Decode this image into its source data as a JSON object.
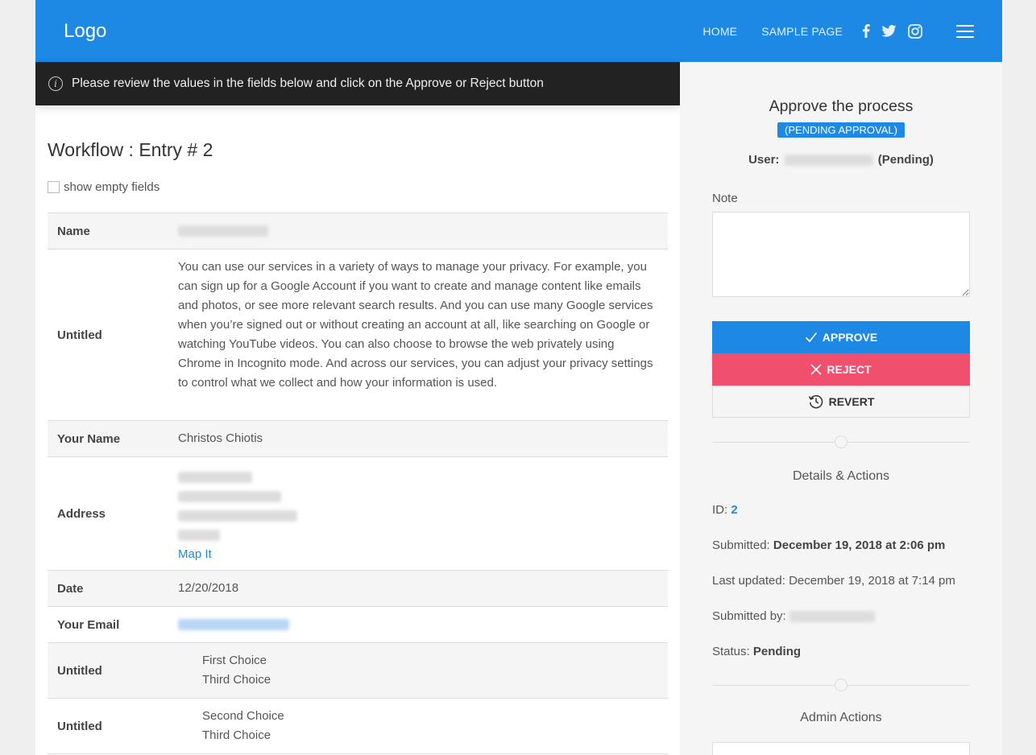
{
  "header": {
    "logo": "Logo",
    "nav": [
      "HOME",
      "SAMPLE PAGE"
    ],
    "social": [
      "facebook-icon",
      "twitter-icon",
      "instagram-icon"
    ]
  },
  "notice": "Please review the values in the fields below and click on the Approve or Reject button",
  "entry": {
    "title": "Workflow : Entry # 2",
    "show_empty_label": "show empty fields",
    "fields": {
      "name_label": "Name",
      "untitled1_label": "Untitled",
      "untitled1_value": "You can use our services in a variety of ways to manage your privacy. For example, you can sign up for a Google Account if you want to create and manage content like emails and photos, or see more relevant search results. And you can use many Google services when you’re signed out or without creating an account at all, like searching on Google or watching YouTube videos. You can also choose to browse the web privately using Chrome in Incognito mode. And across our services, you can adjust your privacy settings to control what we collect and how your information is used.",
      "your_name_label": "Your Name",
      "your_name_value": "Christos Chiotis",
      "address_label": "Address",
      "map_it": "Map It",
      "date_label": "Date",
      "date_value": "12/20/2018",
      "email_label": "Your Email",
      "untitled2_label": "Untitled",
      "untitled2_values": [
        "First Choice",
        "Third Choice"
      ],
      "untitled3_label": "Untitled",
      "untitled3_values": [
        "Second Choice",
        "Third Choice"
      ]
    }
  },
  "sidebar": {
    "approve_title": "Approve the process",
    "badge": "(PENDING APPROVAL)",
    "user_label": "User:",
    "user_status": "(Pending)",
    "note_label": "Note",
    "approve_label": "APPROVE",
    "reject_label": "REJECT",
    "revert_label": "REVERT",
    "details_title": "Details & Actions",
    "id_label": "ID:",
    "id_value": "2",
    "submitted_label": "Submitted:",
    "submitted_value": "December 19, 2018 at 2:06 pm",
    "updated_label": "Last updated:",
    "updated_value": "December 19, 2018 at 7:14 pm",
    "submitted_by_label": "Submitted by:",
    "status_label": "Status:",
    "status_value": "Pending",
    "admin_title": "Admin Actions"
  },
  "colors": {
    "primary": "#1e88e5",
    "reject": "#f0506e",
    "notice_bg": "#222222"
  }
}
